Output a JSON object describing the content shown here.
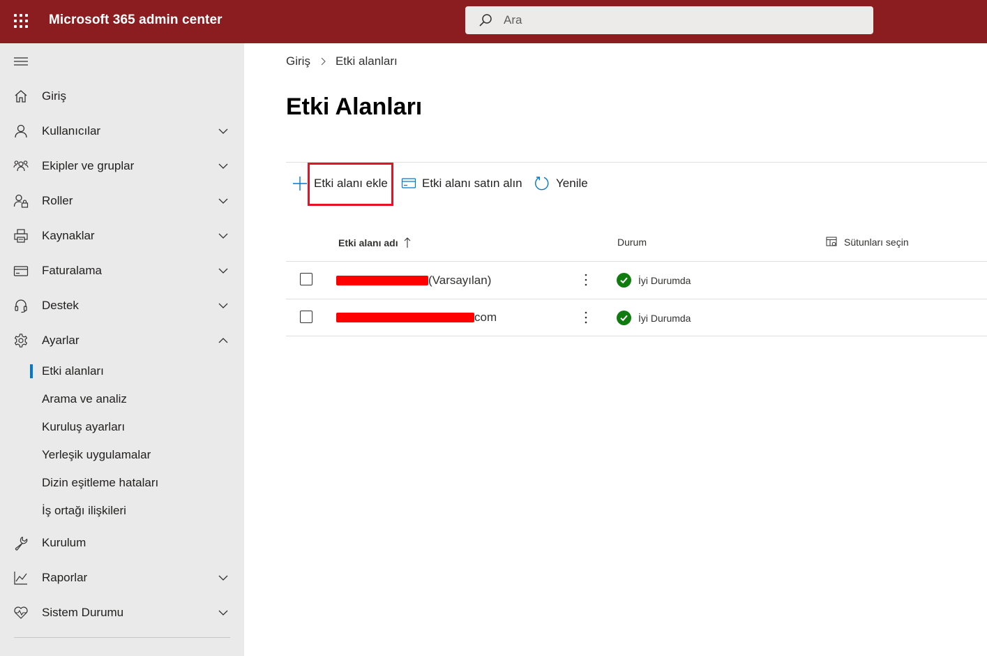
{
  "header": {
    "app_title": "Microsoft 365 admin center",
    "search_placeholder": "Ara"
  },
  "sidebar": {
    "items": [
      {
        "label": "Giriş",
        "icon": "home-icon",
        "expandable": false
      },
      {
        "label": "Kullanıcılar",
        "icon": "person-icon",
        "expandable": true
      },
      {
        "label": "Ekipler ve gruplar",
        "icon": "group-icon",
        "expandable": true
      },
      {
        "label": "Roller",
        "icon": "role-icon",
        "expandable": true
      },
      {
        "label": "Kaynaklar",
        "icon": "printer-icon",
        "expandable": true
      },
      {
        "label": "Faturalama",
        "icon": "credit-card-icon",
        "expandable": true
      },
      {
        "label": "Destek",
        "icon": "headset-icon",
        "expandable": true
      },
      {
        "label": "Ayarlar",
        "icon": "gear-icon",
        "expandable": true,
        "expanded": true
      },
      {
        "label": "Kurulum",
        "icon": "wrench-icon",
        "expandable": false
      },
      {
        "label": "Raporlar",
        "icon": "chart-icon",
        "expandable": true
      },
      {
        "label": "Sistem Durumu",
        "icon": "heart-icon",
        "expandable": true
      }
    ],
    "settings_subitems": [
      {
        "label": "Etki alanları",
        "active": true
      },
      {
        "label": "Arama ve analiz"
      },
      {
        "label": "Kuruluş ayarları"
      },
      {
        "label": "Yerleşik uygulamalar"
      },
      {
        "label": "Dizin eşitleme hataları"
      },
      {
        "label": "İş ortağı ilişkileri"
      }
    ]
  },
  "breadcrumb": {
    "home": "Giriş",
    "current": "Etki alanları"
  },
  "page": {
    "title": "Etki Alanları"
  },
  "commands": {
    "add": "Etki alanı ekle",
    "buy": "Etki alanı satın alın",
    "refresh": "Yenile"
  },
  "table": {
    "columns": {
      "name": "Etki alanı adı",
      "status": "Durum",
      "choose_columns": "Sütunları seçin"
    },
    "rows": [
      {
        "suffix": "(Varsayılan)",
        "status": "İyi Durumda"
      },
      {
        "suffix": "com",
        "status": "İyi Durumda"
      }
    ]
  },
  "colors": {
    "topbar": "#8b1c1f",
    "sidebar": "#eaeaea",
    "accent": "#0078d4",
    "status_ok": "#107c10",
    "highlight": "#e81123"
  }
}
